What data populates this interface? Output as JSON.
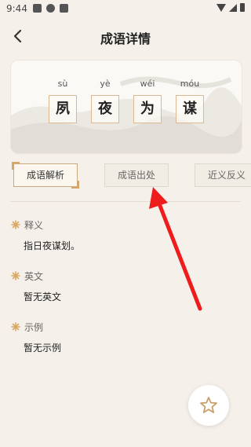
{
  "status_bar": {
    "time": "9:44"
  },
  "header": {
    "title": "成语详情"
  },
  "idiom": {
    "chars": [
      {
        "pinyin": "sù",
        "hanzi": "夙"
      },
      {
        "pinyin": "yè",
        "hanzi": "夜"
      },
      {
        "pinyin": "wéi",
        "hanzi": "为"
      },
      {
        "pinyin": "móu",
        "hanzi": "谋"
      }
    ]
  },
  "tabs": [
    {
      "label": "成语解析",
      "active": true
    },
    {
      "label": "成语出处",
      "active": false
    },
    {
      "label": "近义反义",
      "active": false
    }
  ],
  "sections": {
    "meaning": {
      "title": "释义",
      "body": "指日夜谋划。"
    },
    "english": {
      "title": "英文",
      "body": "暂无英文"
    },
    "example": {
      "title": "示例",
      "body": "暂无示例"
    }
  },
  "colors": {
    "accent": "#d8a765",
    "annotation_arrow": "#ee1c1c",
    "background": "#f5f1ea"
  },
  "icons": {
    "back": "chevron-left-icon",
    "section": "flower-icon",
    "fab": "star-icon"
  }
}
